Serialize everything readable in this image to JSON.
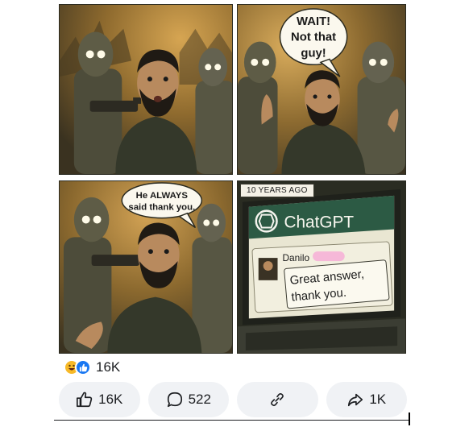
{
  "comic": {
    "panel1": {},
    "panel2": {
      "bubble_lines": [
        "WAIT!",
        "Not that",
        "guy!"
      ]
    },
    "panel3": {
      "bubble_lines": [
        "He ALWAYS",
        "said thank you."
      ]
    },
    "panel4": {
      "caption": "10 YEARS AGO",
      "app_name": "ChatGPT",
      "user_name": "Danilo",
      "message_lines": [
        "Great answer,",
        "thank you."
      ]
    }
  },
  "post": {
    "reaction_icons": [
      "haha-icon",
      "like-icon"
    ],
    "reaction_count": "16K",
    "actions": {
      "like_count": "16K",
      "comment_count": "522",
      "share_count": "1K"
    }
  },
  "colors": {
    "sepia_bg": "#8a6a30",
    "sepia_dark": "#2e2a1c",
    "robot": "#5a5a48",
    "fb_blue": "#1877f2",
    "action_bg": "#f0f2f5",
    "chat_header": "#2c5a44"
  }
}
